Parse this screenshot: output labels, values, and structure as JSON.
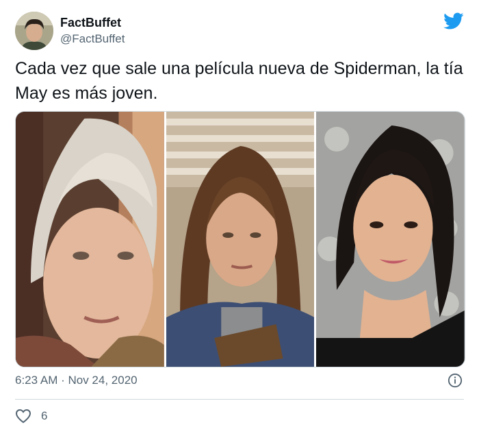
{
  "author": {
    "display_name": "FactBuffet",
    "handle": "@FactBuffet",
    "avatar_icon": "profile-avatar",
    "avatar_badge_text": "FACTBUFFET"
  },
  "brand": {
    "icon": "twitter-bird-icon",
    "color": "#1d9bf0"
  },
  "tweet": {
    "text": "Cada vez que sale una película nueva de Spiderman, la tía May es más joven.",
    "timestamp": "6:23 AM · Nov 24, 2020"
  },
  "media": {
    "photos": [
      {
        "description_icon": "photo-elderly-woman"
      },
      {
        "description_icon": "photo-middle-aged-woman"
      },
      {
        "description_icon": "photo-young-woman"
      }
    ]
  },
  "actions": {
    "like_icon": "heart-icon",
    "like_count": "6",
    "info_icon": "info-icon"
  },
  "colors": {
    "text": "#0f1419",
    "secondary_text": "#536471",
    "divider": "#cfd9de"
  }
}
